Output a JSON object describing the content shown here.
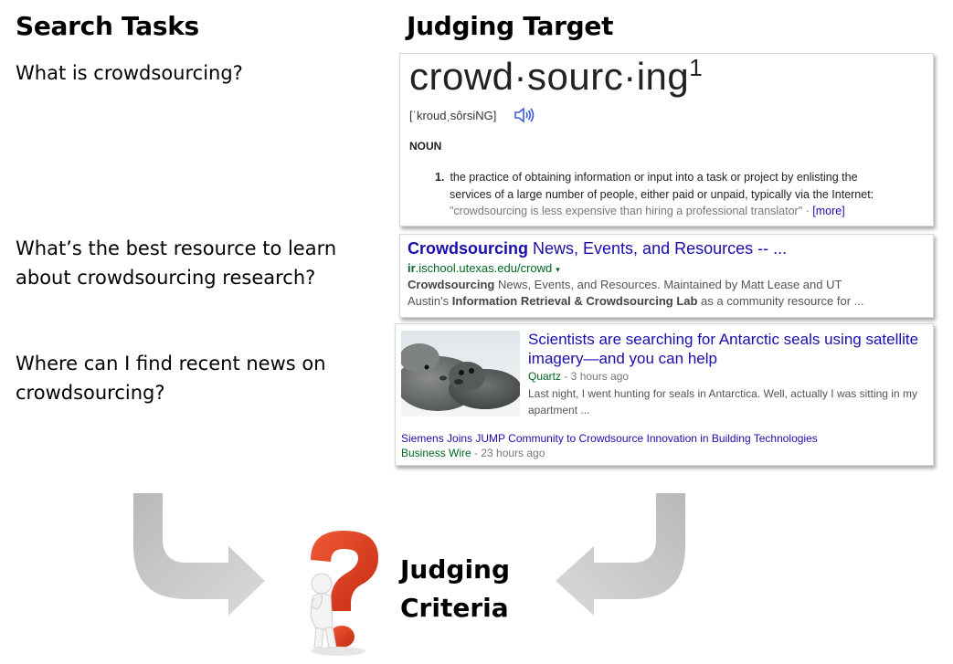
{
  "headings": {
    "left": "Search Tasks",
    "right": "Judging Target"
  },
  "tasks": [
    {
      "text": "What is crowdsourcing?"
    },
    {
      "text": "What’s the best resource to learn about crowdsourcing research?"
    },
    {
      "text": "Where can I find recent news on crowdsourcing?"
    }
  ],
  "dictionary": {
    "word": "crowd·sourc·ing",
    "superscript": "1",
    "pronunciation": "[ˈkroudˌsôrsiNG]",
    "part_of_speech": "NOUN",
    "def_number": "1.",
    "definition_line1": "the practice of obtaining information or input into a task or project by enlisting the",
    "definition_line2": "services of a large number of people, either paid or unpaid, typically via the Internet:",
    "example": "\"crowdsourcing is less expensive than hiring a professional translator\"",
    "separator": " · ",
    "more": "[more]"
  },
  "search_result": {
    "title_bold": "Crowdsourcing",
    "title_rest": " News, Events, and Resources -- ...",
    "url_bold": "ir",
    "url_rest": ".ischool.utexas.edu/crowd",
    "url_caret": "▾",
    "snippet_bold1": "Crowdsourcing",
    "snippet_line1_rest": " News, Events, and Resources. Maintained by Matt Lease and UT",
    "snippet_line2_start": "Austin's ",
    "snippet_bold2": "Information Retrieval & Crowdsourcing Lab",
    "snippet_line2_end": " as a community resource for ..."
  },
  "news": {
    "headline": "Scientists are searching for Antarctic seals using satellite imagery—and you can help",
    "source": "Quartz",
    "time": " - 3 hours ago",
    "snippet": "Last night, I went hunting for seals in Antarctica. Well, actually I was sitting in my apartment ...",
    "headline2": "Siemens Joins JUMP Community to Crowdsource Innovation in Building Technologies",
    "source2": "Business Wire",
    "time2": " - 23 hours ago"
  },
  "criteria": {
    "line1": "Judging",
    "line2": "Criteria"
  },
  "colors": {
    "link": "#1a0dab",
    "url_green": "#006621",
    "arrow_gray": "#c9c9c9",
    "question_red": "#e03a1e"
  }
}
